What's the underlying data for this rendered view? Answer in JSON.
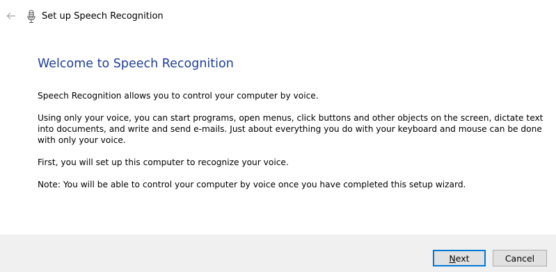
{
  "window": {
    "title": "Set up Speech Recognition",
    "back_icon": "back-arrow-icon",
    "app_icon": "microphone-icon"
  },
  "main": {
    "heading": "Welcome to Speech Recognition",
    "paragraphs": [
      "Speech Recognition allows you to control your computer by voice.",
      "Using only your voice, you can start programs, open menus, click buttons and other objects on the screen, dictate text into documents, and write and send e-mails. Just about everything you do with your keyboard and mouse can be done with only your voice.",
      "First, you will set up this computer to recognize your voice.",
      "Note: You will be able to control your computer by voice once you have completed this setup wizard."
    ]
  },
  "footer": {
    "next": {
      "access_key": "N",
      "rest": "ext"
    },
    "cancel_label": "Cancel"
  },
  "colors": {
    "heading": "#1f3e96",
    "footer_bg": "#f0f0f0",
    "default_button_border": "#0078d7"
  }
}
